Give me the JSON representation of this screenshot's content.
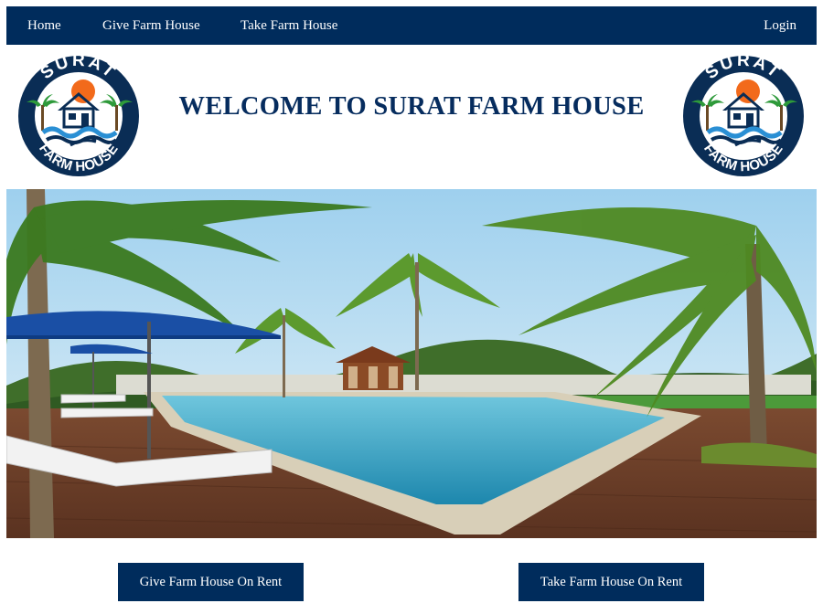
{
  "nav": {
    "home": "Home",
    "give": "Give Farm House",
    "take": "Take Farm House",
    "login": "Login"
  },
  "logo": {
    "top_text": "SURAT",
    "bottom_text": "FARM HOUSE"
  },
  "header": {
    "title": "WELCOME TO SURAT FARM HOUSE"
  },
  "actions": {
    "give_label": "Give Farm House On Rent",
    "take_label": "Take Farm House On Rent"
  },
  "colors": {
    "brand_navy": "#002c5c",
    "title_navy": "#062c5e",
    "logo_orange": "#f26a1b",
    "logo_green": "#2e9a3a",
    "logo_blue": "#2a8fd4"
  }
}
